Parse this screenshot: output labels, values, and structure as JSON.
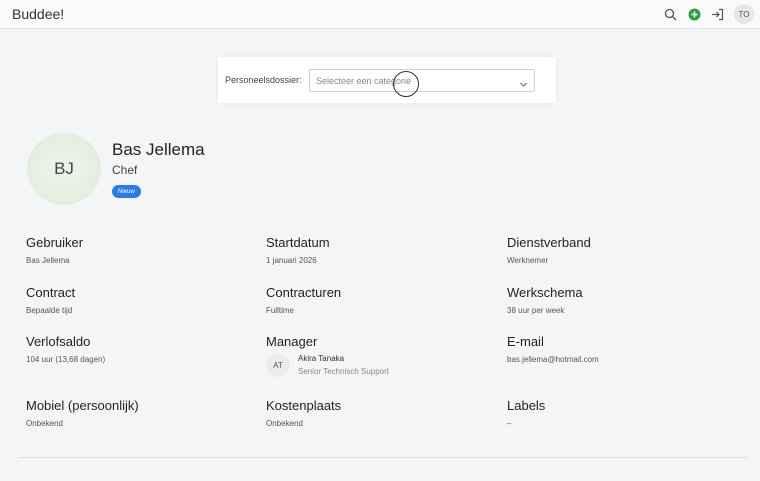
{
  "app": {
    "title": "Buddee!"
  },
  "topbar": {
    "user_initials": "TO"
  },
  "dossier": {
    "label": "Personeelsdossier:",
    "select_value": "Selecteer een categorie"
  },
  "profile": {
    "initials": "BJ",
    "name": "Bas Jellema",
    "role": "Chef",
    "badge": "Nieuw"
  },
  "fields": {
    "gebruiker": {
      "title": "Gebruiker",
      "value": "Bas Jellema"
    },
    "startdatum": {
      "title": "Startdatum",
      "value": "1 januari 2026"
    },
    "dienstverband": {
      "title": "Dienstverband",
      "value": "Werknemer"
    },
    "contract": {
      "title": "Contract",
      "value": "Bepaalde tijd"
    },
    "contracturen": {
      "title": "Contracturen",
      "value": "Fulltime"
    },
    "werkschema": {
      "title": "Werkschema",
      "value": "38 uur per week"
    },
    "verlofsaldo": {
      "title": "Verlofsaldo",
      "value": "104 uur (13,68 dagen)"
    },
    "manager": {
      "title": "Manager",
      "initials": "AT",
      "name": "Akira Tanaka",
      "role": "Senior Technisch Support"
    },
    "email": {
      "title": "E-mail",
      "value": "bas.jellema@hotmail.com"
    },
    "mobiel": {
      "title": "Mobiel (persoonlijk)",
      "value": "Onbekend"
    },
    "kostenplaats": {
      "title": "Kostenplaats",
      "value": "Onbekend"
    },
    "labels": {
      "title": "Labels",
      "value": "–"
    }
  },
  "icons": {
    "search": "search-icon",
    "add": "add-circle-icon",
    "logout": "login-arrow-icon",
    "chevron": "chevron-down-icon"
  },
  "colors": {
    "badge": "#2d7be5",
    "add_icon": "#2e9e47"
  }
}
